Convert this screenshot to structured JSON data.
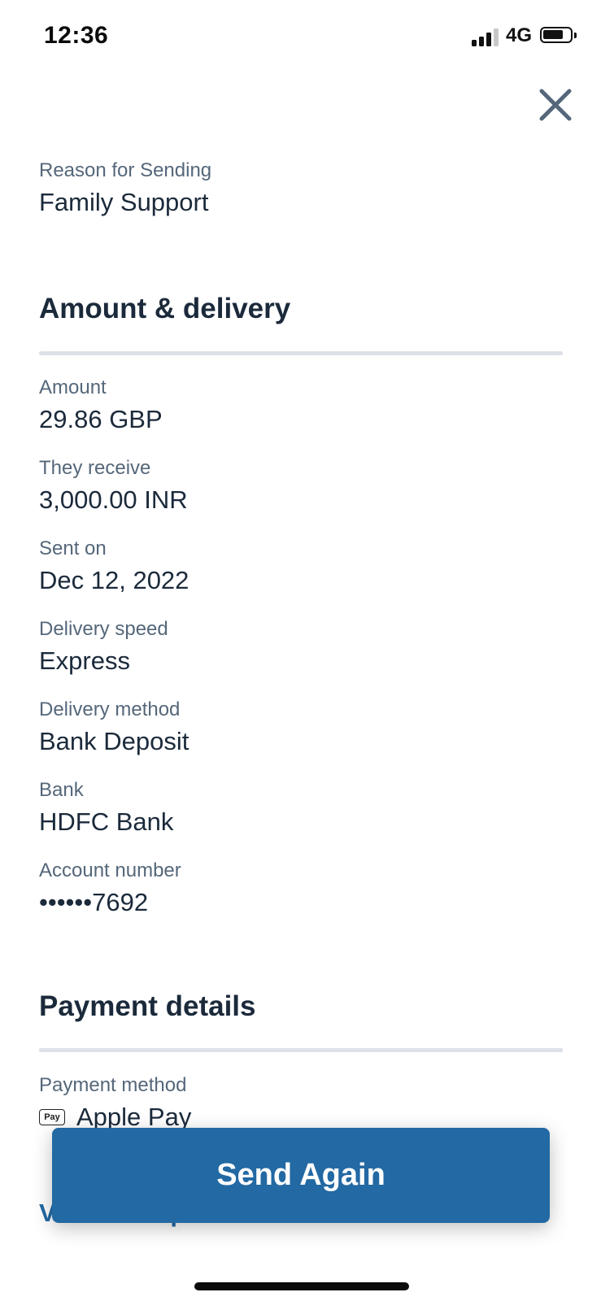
{
  "status_bar": {
    "time": "12:36",
    "network": "4G"
  },
  "reason": {
    "label": "Reason for Sending",
    "value": "Family Support"
  },
  "amount_delivery": {
    "title": "Amount & delivery",
    "fields": [
      {
        "label": "Amount",
        "value": "29.86 GBP"
      },
      {
        "label": "They receive",
        "value": "3,000.00 INR"
      },
      {
        "label": "Sent on",
        "value": "Dec 12, 2022"
      },
      {
        "label": "Delivery speed",
        "value": "Express"
      },
      {
        "label": "Delivery method",
        "value": "Bank Deposit"
      },
      {
        "label": "Bank",
        "value": "HDFC Bank"
      },
      {
        "label": "Account number",
        "value": "••••••7692"
      }
    ]
  },
  "payment_details": {
    "title": "Payment details",
    "method_label": "Payment method",
    "method_badge": "Pay",
    "method_value": "Apple Pay"
  },
  "actions": {
    "view_receipt": "View Receipt",
    "send_again": "Send Again"
  },
  "colors": {
    "primary": "#2369a3",
    "text": "#1b2a3b",
    "muted": "#55677a",
    "divider": "#dde2e8"
  },
  "icons": {
    "close": "close-icon",
    "signal": "signal-icon",
    "battery": "battery-icon",
    "apple_pay": "apple-pay-icon"
  }
}
